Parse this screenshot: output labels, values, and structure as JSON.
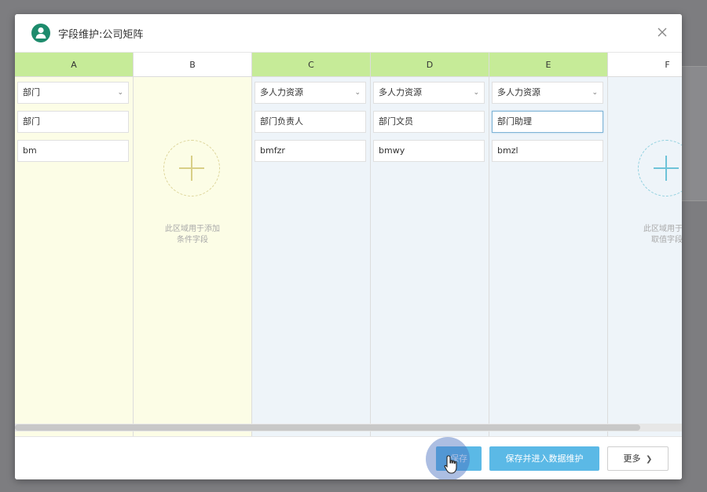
{
  "dialog": {
    "title": "字段维护:公司矩阵",
    "close_glyph": "✕"
  },
  "columns": [
    {
      "header": "A",
      "kind": "data",
      "select": "部门",
      "name": "部门",
      "code": "bm"
    },
    {
      "header": "B",
      "kind": "empty",
      "placeholder": [
        "此区域用于添加",
        "条件字段"
      ]
    },
    {
      "header": "C",
      "kind": "data",
      "select": "多人力资源",
      "name": "部门负责人",
      "code": "bmfzr"
    },
    {
      "header": "D",
      "kind": "data",
      "select": "多人力资源",
      "name": "部门文员",
      "code": "bmwy"
    },
    {
      "header": "E",
      "kind": "data",
      "select": "多人力资源",
      "name": "部门助理",
      "code": "bmzl"
    },
    {
      "header": "F",
      "kind": "empty",
      "placeholder": [
        "此区域用于添",
        "取值字段"
      ]
    }
  ],
  "footer": {
    "save_label": "保存",
    "save_enter_label": "保存并进入数据维护",
    "more_label": "更多",
    "more_glyph": "❯"
  },
  "icons": {
    "select_chevron": "⌄"
  },
  "colors": {
    "header_active": "#c6eb98",
    "condition_bg": "#fcfde6",
    "value_bg": "#eef4f9",
    "primary_button": "#5bb9e6",
    "condition_plus": "#d8cf86",
    "value_plus": "#6ec3d8"
  }
}
